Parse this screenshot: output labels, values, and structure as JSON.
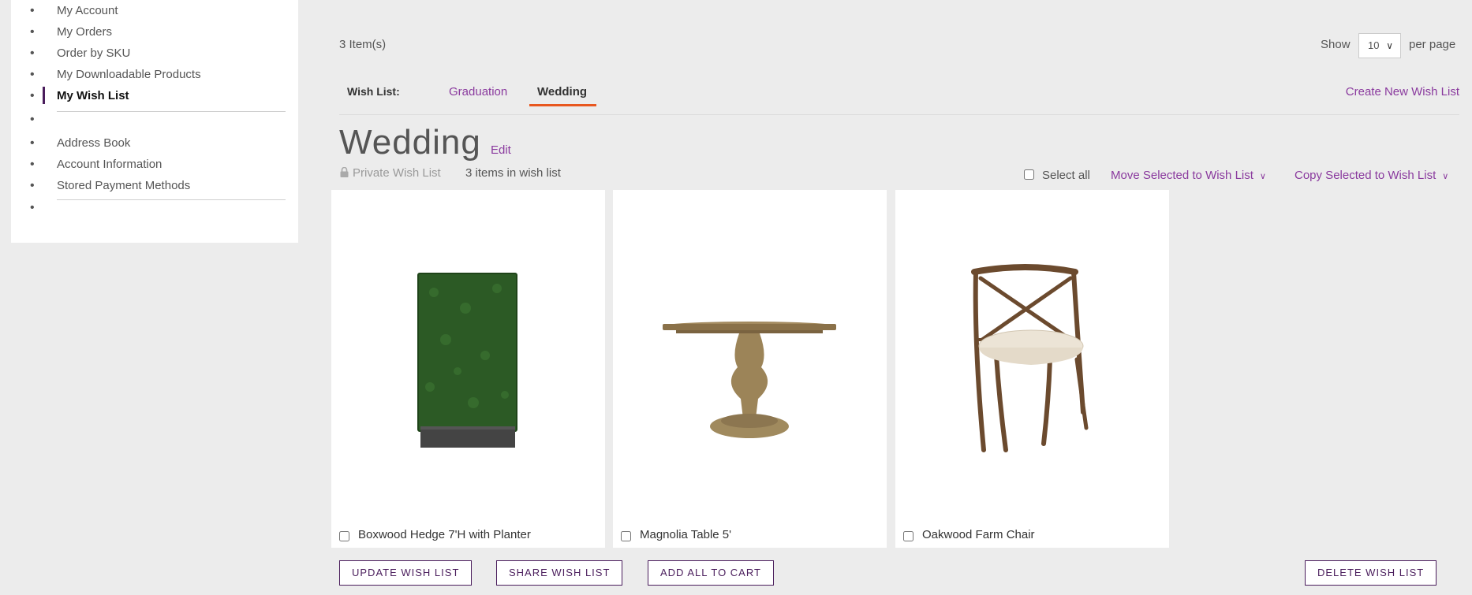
{
  "sidebar": {
    "items": [
      {
        "label": "My Account"
      },
      {
        "label": "My Orders"
      },
      {
        "label": "Order by SKU"
      },
      {
        "label": "My Downloadable Products"
      },
      {
        "label": "My Wish List",
        "active": true
      },
      {
        "label": ""
      },
      {
        "label": "Address Book"
      },
      {
        "label": "Account Information"
      },
      {
        "label": "Stored Payment Methods"
      },
      {
        "label": ""
      }
    ]
  },
  "toolbar": {
    "items_count": "3 Item(s)",
    "show_label": "Show",
    "limit_value": "10",
    "per_page_label": "per page"
  },
  "tabs": {
    "title": "Wish List:",
    "items": [
      {
        "label": "Graduation"
      },
      {
        "label": "Wedding",
        "active": true
      }
    ],
    "create_label": "Create New Wish List"
  },
  "wishlist": {
    "title": "Wedding",
    "edit_label": "Edit",
    "privacy_label": "Private Wish List",
    "items_text": "3 items in wish list",
    "select_all_label": "Select all",
    "move_label": "Move Selected to Wish List",
    "copy_label": "Copy Selected to Wish List"
  },
  "products": [
    {
      "name": "Boxwood Hedge 7'H with Planter",
      "image": "hedge-image"
    },
    {
      "name": "Magnolia Table 5'",
      "image": "table-image"
    },
    {
      "name": "Oakwood Farm Chair",
      "image": "chair-image"
    }
  ],
  "actions": {
    "update": "UPDATE WISH LIST",
    "share": "SHARE WISH LIST",
    "add_all": "ADD ALL TO CART",
    "delete": "DELETE WISH LIST"
  },
  "colors": {
    "accent": "#8a3a9e",
    "brand_dark": "#4a1d5c",
    "tab_underline": "#e8571f",
    "background": "#ececec"
  }
}
